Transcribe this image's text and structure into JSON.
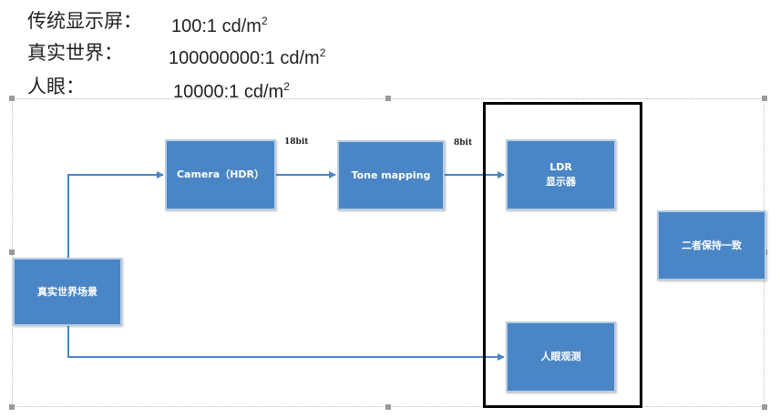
{
  "header": {
    "lines": [
      {
        "label": "传统显示屏：",
        "value": "100:1 cd/m",
        "sup": "2"
      },
      {
        "label": "真实世界：",
        "value": "100000000:1 cd/m",
        "sup": "2"
      },
      {
        "label": "人眼：",
        "value": "10000:1 cd/m",
        "sup": "2"
      }
    ]
  },
  "diagram": {
    "boxes": {
      "real_scene": "真实世界场景",
      "camera": "Camera（HDR）",
      "tone_mapping": "Tone mapping",
      "ldr_line1": "LDR",
      "ldr_line2": "显示器",
      "human_eye": "人眼观测",
      "consistent": "二者保持一致"
    },
    "edge_labels": {
      "camera_to_tone": "18bit",
      "tone_to_ldr": "8bit"
    },
    "colors": {
      "box_fill": "#4a86c5",
      "box_border": "#b8cde3",
      "arrow": "#4a86c5",
      "emphasis": "#000000"
    }
  }
}
